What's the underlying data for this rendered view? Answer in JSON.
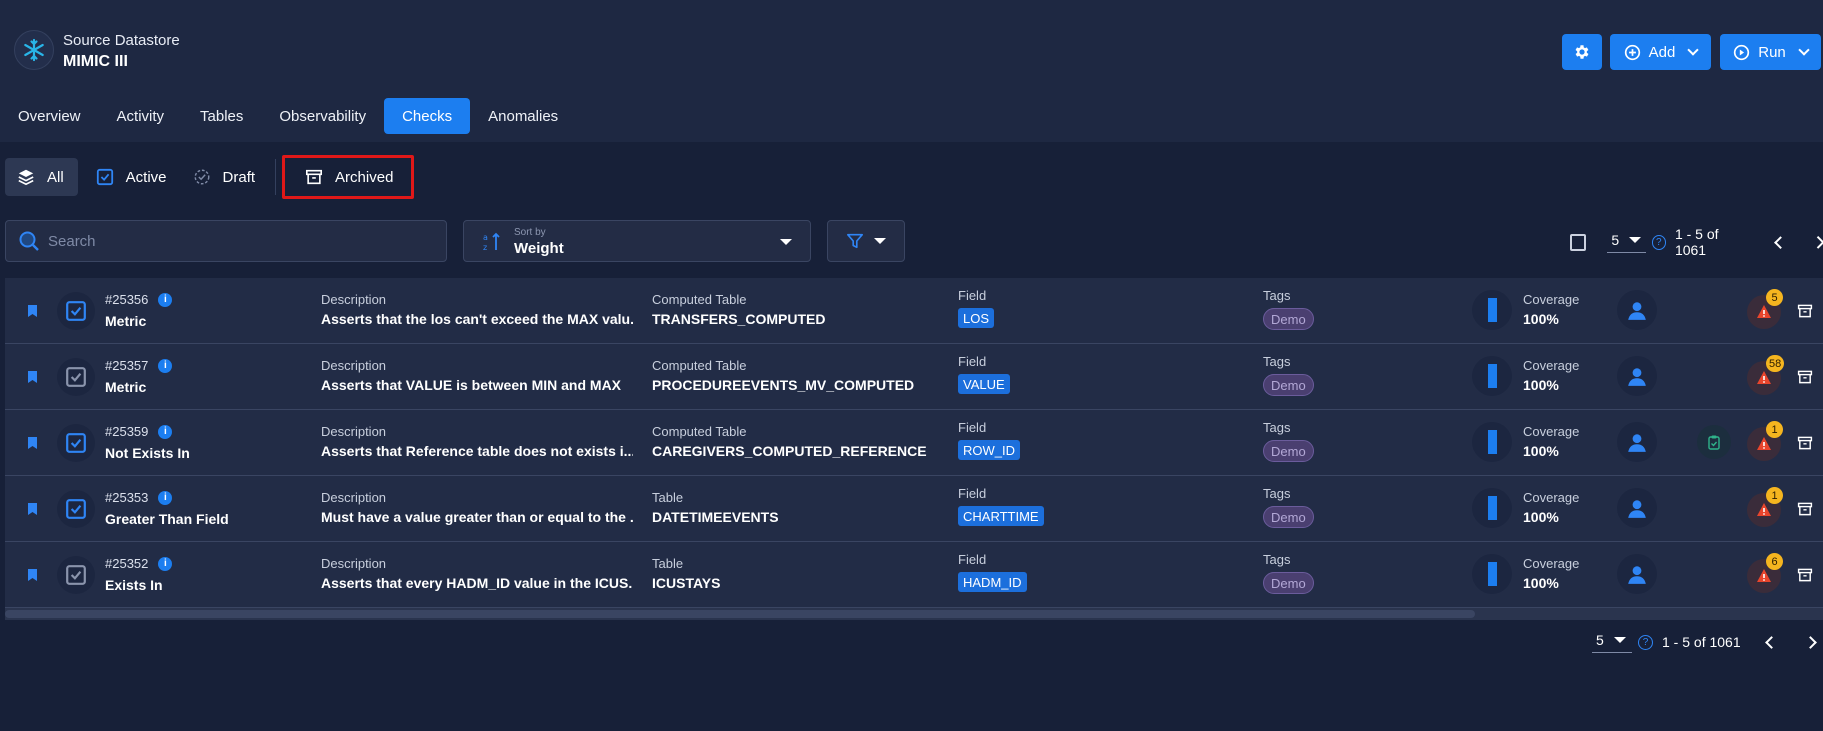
{
  "header": {
    "subtitle": "Source Datastore",
    "title": "MIMIC III",
    "add_label": "Add",
    "run_label": "Run"
  },
  "tabs": [
    {
      "label": "Overview"
    },
    {
      "label": "Activity"
    },
    {
      "label": "Tables"
    },
    {
      "label": "Observability"
    },
    {
      "label": "Checks",
      "active": true
    },
    {
      "label": "Anomalies"
    }
  ],
  "status_filter": {
    "all": "All",
    "active": "Active",
    "draft": "Draft",
    "archived": "Archived"
  },
  "search": {
    "placeholder": "Search"
  },
  "sort": {
    "caption": "Sort by",
    "value": "Weight"
  },
  "pagination": {
    "per_page": "5",
    "range": "1 - 5 of 1061"
  },
  "columns": {
    "description": "Description",
    "field": "Field",
    "tags": "Tags",
    "coverage": "Coverage"
  },
  "rows": [
    {
      "id": "#25356",
      "type": "Metric",
      "description": "Asserts that the los can't exceed the MAX valu...",
      "table_label": "Computed Table",
      "table": "TRANSFERS_COMPUTED",
      "field": "LOS",
      "tag": "Demo",
      "coverage": "100%",
      "anomalies": "5",
      "active": true,
      "has_clip": false
    },
    {
      "id": "#25357",
      "type": "Metric",
      "description": "Asserts that VALUE is between MIN and MAX",
      "table_label": "Computed Table",
      "table": "PROCEDUREEVENTS_MV_COMPUTED",
      "field": "VALUE",
      "tag": "Demo",
      "coverage": "100%",
      "anomalies": "58",
      "active": false,
      "has_clip": false
    },
    {
      "id": "#25359",
      "type": "Not Exists In",
      "description": "Asserts that Reference table does not exists i...",
      "table_label": "Computed Table",
      "table": "CAREGIVERS_COMPUTED_REFERENCE",
      "field": "ROW_ID",
      "tag": "Demo",
      "coverage": "100%",
      "anomalies": "1",
      "active": true,
      "has_clip": true
    },
    {
      "id": "#25353",
      "type": "Greater Than Field",
      "description": "Must have a value greater than or equal to the ...",
      "table_label": "Table",
      "table": "DATETIMEEVENTS",
      "field": "CHARTTIME",
      "tag": "Demo",
      "coverage": "100%",
      "anomalies": "1",
      "active": true,
      "has_clip": false
    },
    {
      "id": "#25352",
      "type": "Exists In",
      "description": "Asserts that every HADM_ID value in the ICUS...",
      "table_label": "Table",
      "table": "ICUSTAYS",
      "field": "HADM_ID",
      "tag": "Demo",
      "coverage": "100%",
      "anomalies": "6",
      "active": false,
      "has_clip": false
    }
  ],
  "colors": {
    "background": "#172038",
    "header": "#1e2842",
    "accent": "#1c7ef0",
    "highlight_border": "#e01818",
    "badge": "#f5b51f"
  }
}
